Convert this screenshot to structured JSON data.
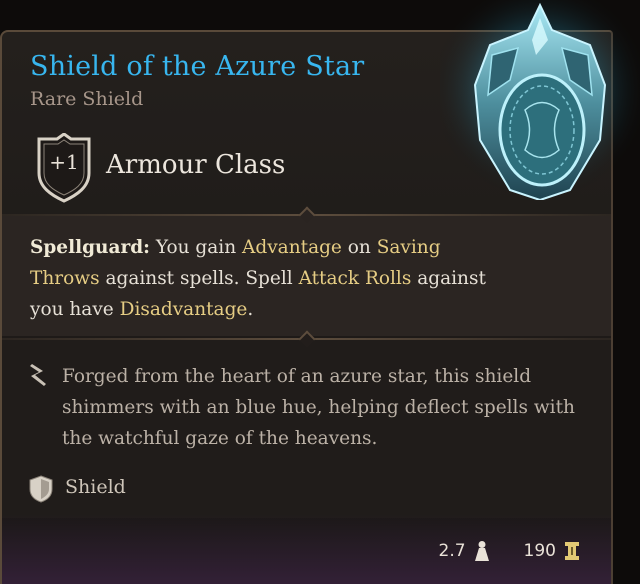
{
  "item": {
    "name": "Shield of the Azure Star",
    "rarity": "Rare Shield",
    "icon": "shield-art-icon"
  },
  "armour": {
    "value": "+1",
    "label": "Armour Class"
  },
  "passive": {
    "title": "Spellguard:",
    "text_1": " You gain ",
    "kw_advantage": "Advantage",
    "text_2": " on ",
    "kw_saving_throws": "Saving Throws",
    "text_3": " against spells. Spell ",
    "kw_attack_rolls": "Attack Rolls",
    "text_4": " against you have ",
    "kw_disadvantage": "Disadvantage",
    "text_5": "."
  },
  "lore": {
    "text": "Forged from the heart of an azure star, this shield shimmers with an blue hue, helping deflect spells with the watchful gaze of the heavens."
  },
  "type": {
    "label": "Shield"
  },
  "stats": {
    "weight": "2.7",
    "value": "190"
  },
  "colors": {
    "name": "#38b6ef",
    "keyword": "#e6cd84",
    "rarity": "#a7968a"
  }
}
